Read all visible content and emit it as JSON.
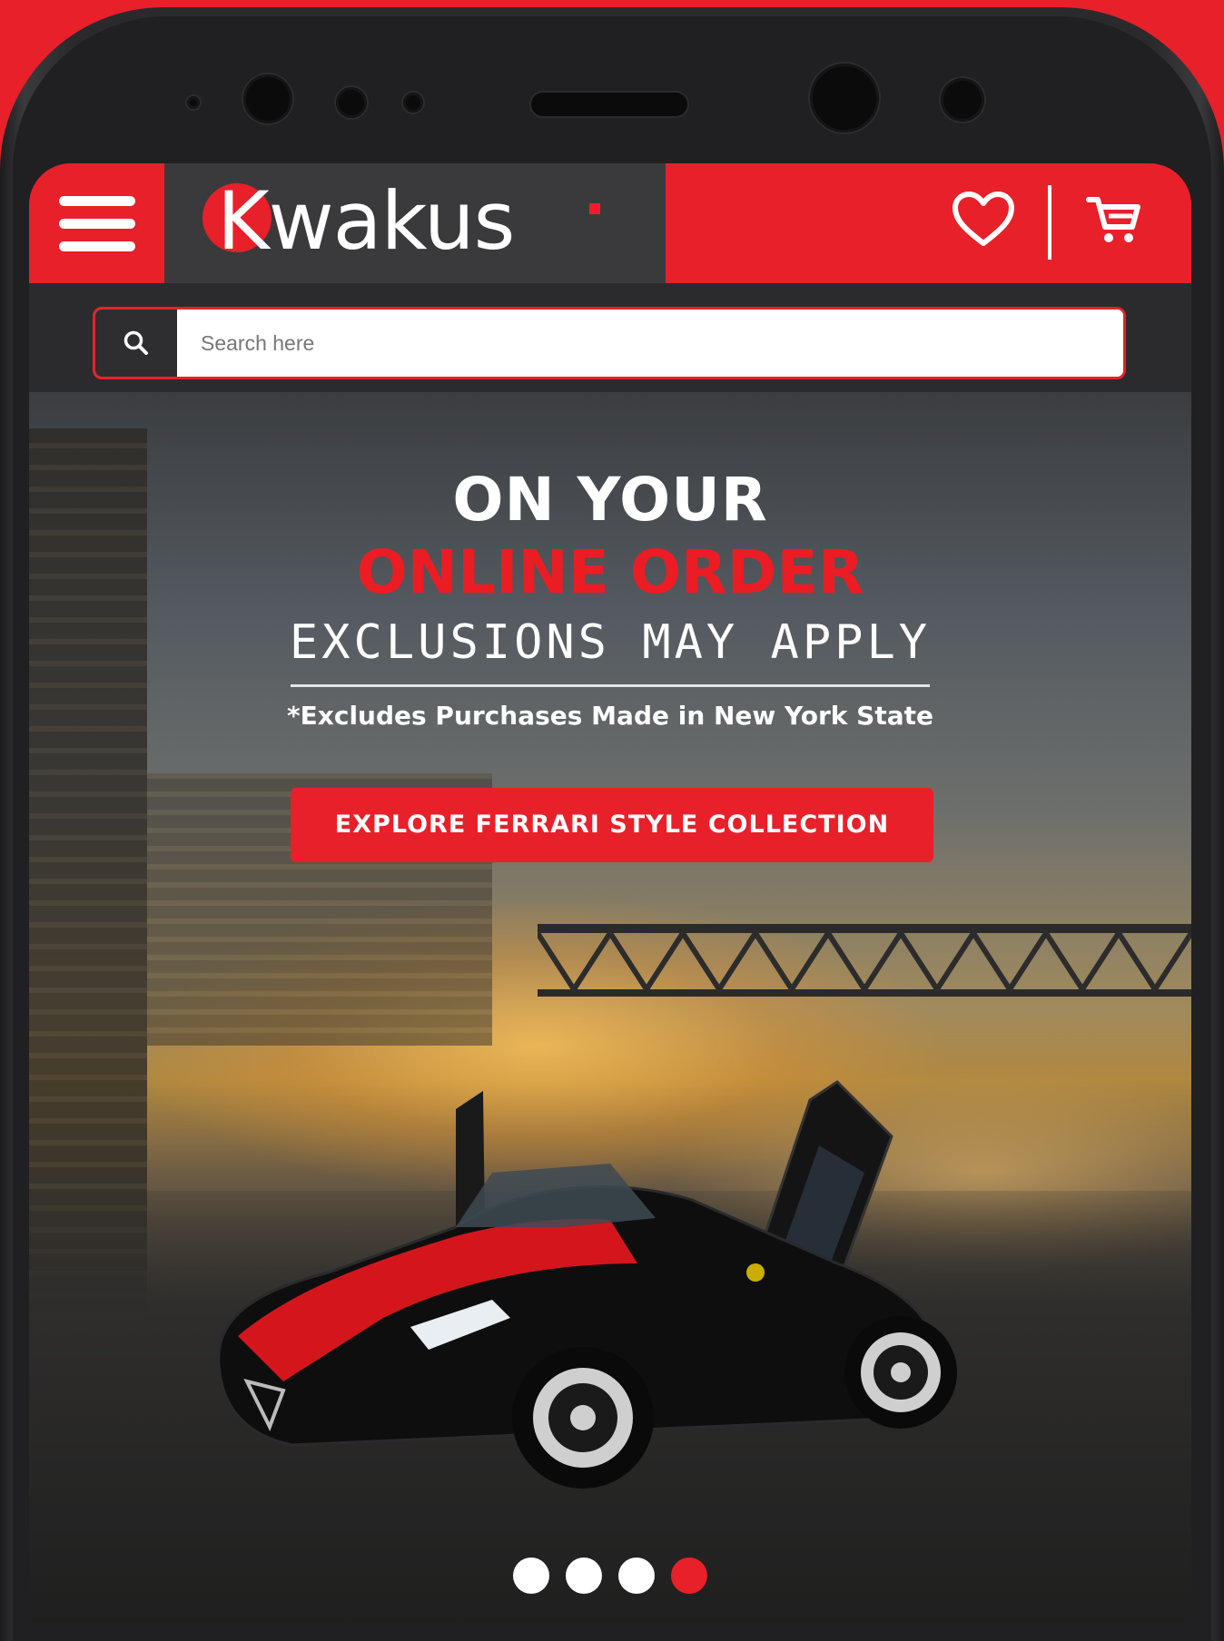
{
  "brand": {
    "name": "Kwakus",
    "accent": "#e8202a",
    "dark": "#3a3a3c"
  },
  "header": {
    "menu_icon": "hamburger-menu-icon",
    "logo_text": "Kwakus",
    "wishlist_icon": "heart-icon",
    "cart_icon": "shopping-cart-icon"
  },
  "search": {
    "placeholder": "Search here",
    "value": "",
    "icon": "search-icon"
  },
  "hero": {
    "line1": "ON YOUR",
    "line2": "ONLINE ORDER",
    "line3": "EXCLUSIONS MAY APPLY",
    "note": "*Excludes Purchases Made in New York State",
    "cta_label": "EXPLORE FERRARI STYLE COLLECTION"
  },
  "carousel": {
    "slides": 4,
    "active_slide": 4
  }
}
